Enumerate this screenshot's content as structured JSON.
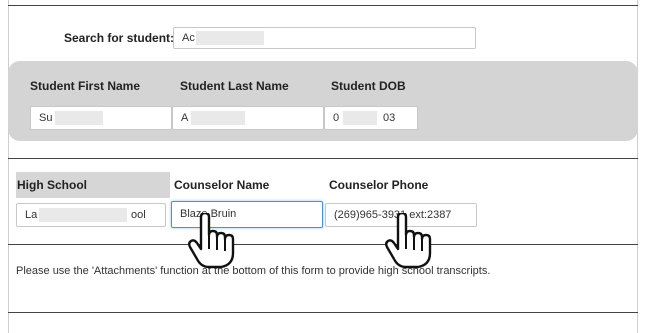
{
  "search": {
    "label": "Search for student:",
    "value": "Ac"
  },
  "student": {
    "first_name_label": "Student First Name",
    "first_name_value": "Su",
    "last_name_label": "Student Last Name",
    "last_name_value": "A",
    "dob_label": "Student DOB",
    "dob_value_start": "0",
    "dob_value_end": "03"
  },
  "school": {
    "high_school_label": "High School",
    "high_school_value_start": "La",
    "high_school_value_end": "ool",
    "counselor_name_label": "Counselor Name",
    "counselor_name_value": "Blaze Bruin",
    "counselor_phone_label": "Counselor Phone",
    "counselor_phone_value": "(269)965-3931 ext:2387"
  },
  "note": {
    "text": "Please use the 'Attachments' function at the bottom of this form to provide high school transcripts."
  },
  "icons": [
    "hand-pointer-icon"
  ],
  "colors": {
    "panel": "#d4d4d4",
    "focus_border": "#4a90d9"
  }
}
